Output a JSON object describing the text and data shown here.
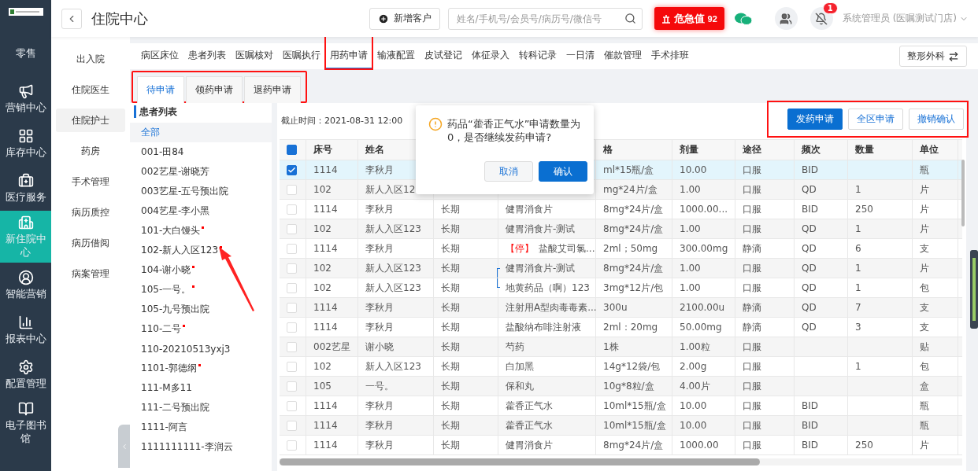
{
  "sidebar": {
    "items": [
      {
        "label": "零售",
        "selected": false
      },
      {
        "label": "营销中心",
        "selected": false
      },
      {
        "label": "库存中心",
        "selected": false
      },
      {
        "label": "医疗服务",
        "selected": false
      },
      {
        "label": "新住院中心",
        "selected": true
      },
      {
        "label": "智能营销",
        "selected": false
      },
      {
        "label": "报表中心",
        "selected": false
      },
      {
        "label": "配置管理",
        "selected": false
      },
      {
        "label": "电子图书馆",
        "selected": false
      }
    ]
  },
  "header": {
    "title": "住院中心",
    "new_customer": "新增客户",
    "search": {
      "placeholder": "姓名/手机号/会员号/病历号/微信号"
    },
    "critical": {
      "label": "危急值",
      "count": "92"
    },
    "notification_badge": "1",
    "user": "系统管理员 (医嘱测试门店)"
  },
  "subnav": {
    "items": [
      {
        "label": "出入院",
        "selected": false
      },
      {
        "label": "住院医生",
        "selected": false
      },
      {
        "label": "住院护士",
        "selected": true
      },
      {
        "label": "药房",
        "selected": false
      },
      {
        "label": "手术管理",
        "selected": false
      },
      {
        "label": "病历质控",
        "selected": false
      },
      {
        "label": "病历借阅",
        "selected": false
      },
      {
        "label": "病案管理",
        "selected": false
      }
    ]
  },
  "tabs": [
    {
      "label": "病区床位",
      "selected": false,
      "annotated": false
    },
    {
      "label": "患者列表",
      "selected": false,
      "annotated": false
    },
    {
      "label": "医嘱核对",
      "selected": false,
      "annotated": false
    },
    {
      "label": "医嘱执行",
      "selected": false,
      "annotated": false
    },
    {
      "label": "用药申请",
      "selected": true,
      "annotated": true
    },
    {
      "label": "输液配置",
      "selected": false,
      "annotated": false
    },
    {
      "label": "皮试登记",
      "selected": false,
      "annotated": false
    },
    {
      "label": "体征录入",
      "selected": false,
      "annotated": false
    },
    {
      "label": "转科记录",
      "selected": false,
      "annotated": false
    },
    {
      "label": "一日清",
      "selected": false,
      "annotated": false
    },
    {
      "label": "催款管理",
      "selected": false,
      "annotated": false
    },
    {
      "label": "手术排班",
      "selected": false,
      "annotated": false
    }
  ],
  "department_button": "整形外科",
  "subtabs": {
    "annotated": true,
    "items": [
      {
        "label": "待申请",
        "selected": true
      },
      {
        "label": "领药申请",
        "selected": false
      },
      {
        "label": "退药申请",
        "selected": false
      }
    ]
  },
  "patients": {
    "title": "患者列表",
    "items": [
      {
        "label": "全部",
        "selected": true,
        "flag": false,
        "pointed": false
      },
      {
        "label": "001-田84",
        "selected": false,
        "flag": false,
        "pointed": false
      },
      {
        "label": "002艺星-谢晓芳",
        "selected": false,
        "flag": false,
        "pointed": false
      },
      {
        "label": "003艺星-五号预出院",
        "selected": false,
        "flag": false,
        "pointed": false
      },
      {
        "label": "004艺星-李小黑",
        "selected": false,
        "flag": false,
        "pointed": false
      },
      {
        "label": "101-大白馒头",
        "selected": false,
        "flag": true,
        "pointed": false
      },
      {
        "label": "102-新人入区123",
        "selected": false,
        "flag": true,
        "pointed": true
      },
      {
        "label": "104-谢小晓",
        "selected": false,
        "flag": true,
        "pointed": false
      },
      {
        "label": "105-一号。",
        "selected": false,
        "flag": true,
        "pointed": false
      },
      {
        "label": "105-九号预出院",
        "selected": false,
        "flag": false,
        "pointed": false
      },
      {
        "label": "110-二号",
        "selected": false,
        "flag": true,
        "pointed": false
      },
      {
        "label": "110-20210513yxj3",
        "selected": false,
        "flag": false,
        "pointed": false
      },
      {
        "label": "1101-郭德纲",
        "selected": false,
        "flag": true,
        "pointed": false
      },
      {
        "label": "111-M多11",
        "selected": false,
        "flag": false,
        "pointed": false
      },
      {
        "label": "111-二号预出院",
        "selected": false,
        "flag": false,
        "pointed": false
      },
      {
        "label": "1111-阿言",
        "selected": false,
        "flag": false,
        "pointed": false
      },
      {
        "label": "1111111111-李润云",
        "selected": false,
        "flag": false,
        "pointed": false
      }
    ]
  },
  "cutoff": "截止时间：2021-08-31 12:00",
  "actions": {
    "annotated": true,
    "buttons": [
      {
        "label": "发药申请",
        "kind": "primary"
      },
      {
        "label": "全区申请",
        "kind": "outline"
      },
      {
        "label": "撤销确认",
        "kind": "outline"
      }
    ]
  },
  "table": {
    "select_all_indeterminate": true,
    "columns": [
      "床号",
      "姓名",
      null,
      null,
      "格",
      "剂量",
      "途径",
      "频次",
      "数量",
      "单位"
    ],
    "rows": [
      {
        "checked": true,
        "cells": [
          "1114",
          "李秋月",
          null,
          null,
          "ml*15瓶/盒",
          "10.00",
          "口服",
          "BID",
          null,
          "瓶"
        ]
      },
      {
        "checked": false,
        "cells": [
          "102",
          "新人入区12",
          null,
          null,
          "mg*24片/盒",
          "1.00",
          "口服",
          "QD",
          "1",
          "片"
        ]
      },
      {
        "checked": false,
        "cells": [
          "1114",
          "李秋月",
          "长期",
          "健胃消食片",
          "8mg*24片/盒",
          "1000.00...",
          "口服",
          "BID",
          "250",
          "片"
        ]
      },
      {
        "checked": false,
        "cells": [
          "102",
          "新人入区123",
          "长期",
          "健胃消食片-测试",
          "8mg*24片/盒",
          "1.00",
          "口服",
          "QD",
          "1",
          "片"
        ]
      },
      {
        "checked": false,
        "tag": "【停】",
        "cells": [
          "1114",
          "李秋月",
          "长期",
          "盐酸艾司氯...",
          "2ml；50mg",
          "300.00mg",
          "静滴",
          "QD",
          "6",
          "支"
        ]
      },
      {
        "checked": false,
        "group_start": true,
        "cells": [
          "102",
          "新人入区123",
          "长期",
          "健胃消食片-测试",
          "8mg*24片/盒",
          "1.00",
          "口服",
          "QD",
          "1",
          "片"
        ]
      },
      {
        "checked": false,
        "group_end": true,
        "cells": [
          "102",
          "新人入区123",
          "长期",
          "地黄药品（啊）123",
          "3mg*12片/包",
          "1.00",
          "口服",
          "QD",
          "1",
          "包"
        ]
      },
      {
        "checked": false,
        "cells": [
          "1114",
          "李秋月",
          "长期",
          "注射用A型肉毒毒素...",
          "300u",
          "2100.00u",
          "静滴",
          "QD",
          "7",
          "支"
        ]
      },
      {
        "checked": false,
        "cells": [
          "1114",
          "李秋月",
          "长期",
          "盐酸纳布啡注射液",
          "2ml：20mg",
          "50.00mg",
          "静滴",
          "QD",
          "3",
          "支"
        ]
      },
      {
        "checked": false,
        "cells": [
          "002艺星",
          "谢小晓",
          "长期",
          "芍药",
          "1株",
          "1.00粒",
          "口服",
          null,
          null,
          "贴"
        ]
      },
      {
        "checked": false,
        "cells": [
          "102",
          "新人入区123",
          "长期",
          "白加黑",
          "14g*12袋/包",
          "2.00g",
          "口服",
          null,
          "1",
          "包"
        ]
      },
      {
        "checked": false,
        "cells": [
          "105",
          "一号。",
          "长期",
          "保和丸",
          "10g*8粒/盒",
          "4.00片",
          "口服",
          null,
          null,
          "盒"
        ]
      },
      {
        "checked": false,
        "cells": [
          "1114",
          "李秋月",
          "长期",
          "藿香正气水",
          "10ml*15瓶/盒",
          "10.00",
          "口服",
          "BID",
          null,
          "瓶"
        ]
      },
      {
        "checked": false,
        "cells": [
          "1114",
          "李秋月",
          "长期",
          "藿香正气水",
          "10ml*15瓶/盒",
          "10.00",
          "口服",
          "BID",
          null,
          "瓶"
        ]
      },
      {
        "checked": false,
        "cells": [
          "1114",
          "李秋月",
          "长期",
          "健胃消食片",
          "8mg*24片/盒",
          "1000.00",
          "口服",
          "BID",
          "250",
          "片"
        ]
      }
    ]
  },
  "dialog": {
    "message": "药品“藿香正气水”申请数量为0，是否继续发药申请?",
    "buttons": [
      {
        "label": "取消",
        "kind": "outline"
      },
      {
        "label": "确认",
        "kind": "primary"
      }
    ]
  }
}
